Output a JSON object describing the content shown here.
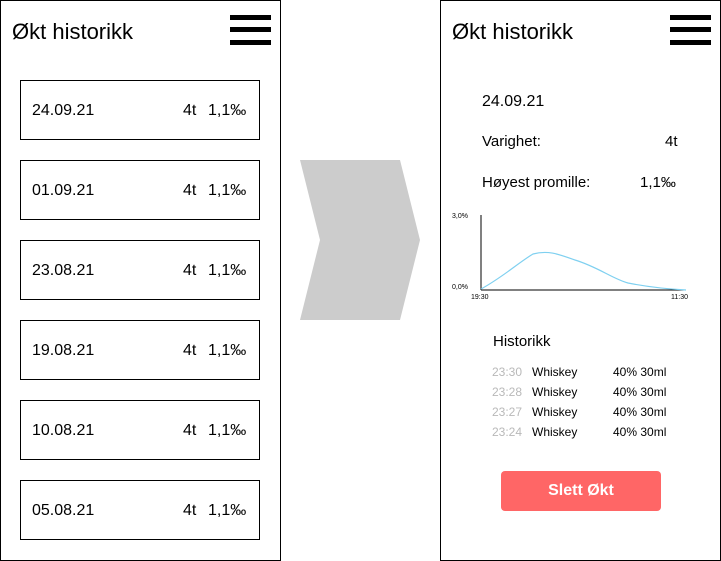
{
  "list_screen": {
    "title": "Økt historikk",
    "sessions": [
      {
        "date": "24.09.21",
        "duration": "4t",
        "promille": "1,1‰"
      },
      {
        "date": "01.09.21",
        "duration": "4t",
        "promille": "1,1‰"
      },
      {
        "date": "23.08.21",
        "duration": "4t",
        "promille": "1,1‰"
      },
      {
        "date": "19.08.21",
        "duration": "4t",
        "promille": "1,1‰"
      },
      {
        "date": "10.08.21",
        "duration": "4t",
        "promille": "1,1‰"
      },
      {
        "date": "05.08.21",
        "duration": "4t",
        "promille": "1,1‰"
      }
    ]
  },
  "detail_screen": {
    "title": "Økt historikk",
    "date": "24.09.21",
    "duration_label": "Varighet:",
    "duration_value": "4t",
    "max_label": "Høyest promille:",
    "max_value": "1,1‰",
    "chart": {
      "y_top_label": "3,0%",
      "y_bottom_label": "0,0%",
      "x_start_label": "19:30",
      "x_end_label": "11:30",
      "line_color": "#7fd0f0"
    },
    "history_title": "Historikk",
    "history": [
      {
        "time": "23:30",
        "drink": "Whiskey",
        "amount": "40% 30ml"
      },
      {
        "time": "23:28",
        "drink": "Whiskey",
        "amount": "40% 30ml"
      },
      {
        "time": "23:27",
        "drink": "Whiskey",
        "amount": "40% 30ml"
      },
      {
        "time": "23:24",
        "drink": "Whiskey",
        "amount": "40% 30ml"
      }
    ],
    "delete_label": "Slett Økt",
    "delete_color": "#ff6666"
  },
  "colors": {
    "arrow": "#cccccc",
    "timestamp": "#b9b9b9"
  }
}
